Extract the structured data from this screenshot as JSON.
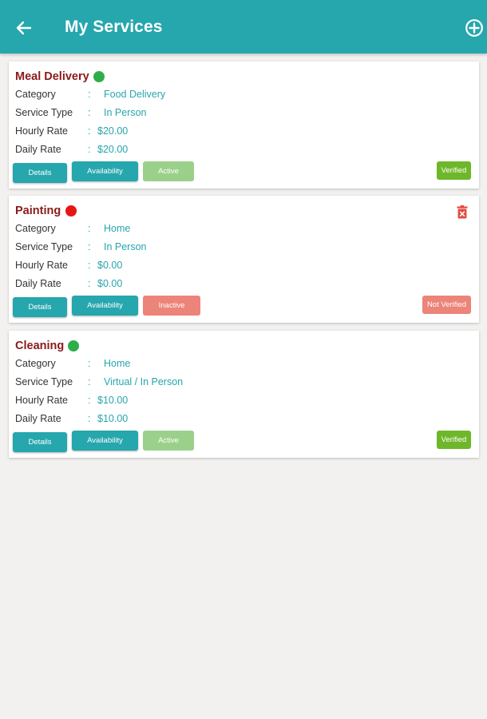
{
  "header": {
    "title": "My Services"
  },
  "labels": {
    "category": "Category",
    "service_type": "Service Type",
    "hourly_rate": "Hourly Rate",
    "daily_rate": "Daily Rate",
    "colon": ":",
    "details": "Details",
    "availability": "Availability"
  },
  "colors": {
    "primary": "#26a6ad",
    "title": "#8a1a1a",
    "active_dot": "#2eae4a",
    "inactive_dot": "#e81515",
    "verified": "#6fb72a",
    "not_verified": "#ec8479",
    "active_button": "#9bd08a",
    "inactive_button": "#ec8479"
  },
  "services": [
    {
      "name": "Meal Delivery",
      "category": "Food Delivery",
      "service_type": "In Person",
      "hourly_rate": "$20.00",
      "daily_rate": "$20.00",
      "status": "Active",
      "verification": "Verified"
    },
    {
      "name": "Painting",
      "category": "Home",
      "service_type": "In Person",
      "hourly_rate": "$0.00",
      "daily_rate": "$0.00",
      "status": "Inactive",
      "verification": "Not Verified"
    },
    {
      "name": "Cleaning",
      "category": "Home",
      "service_type": "Virtual / In Person",
      "hourly_rate": "$10.00",
      "daily_rate": "$10.00",
      "status": "Active",
      "verification": "Verified"
    }
  ]
}
